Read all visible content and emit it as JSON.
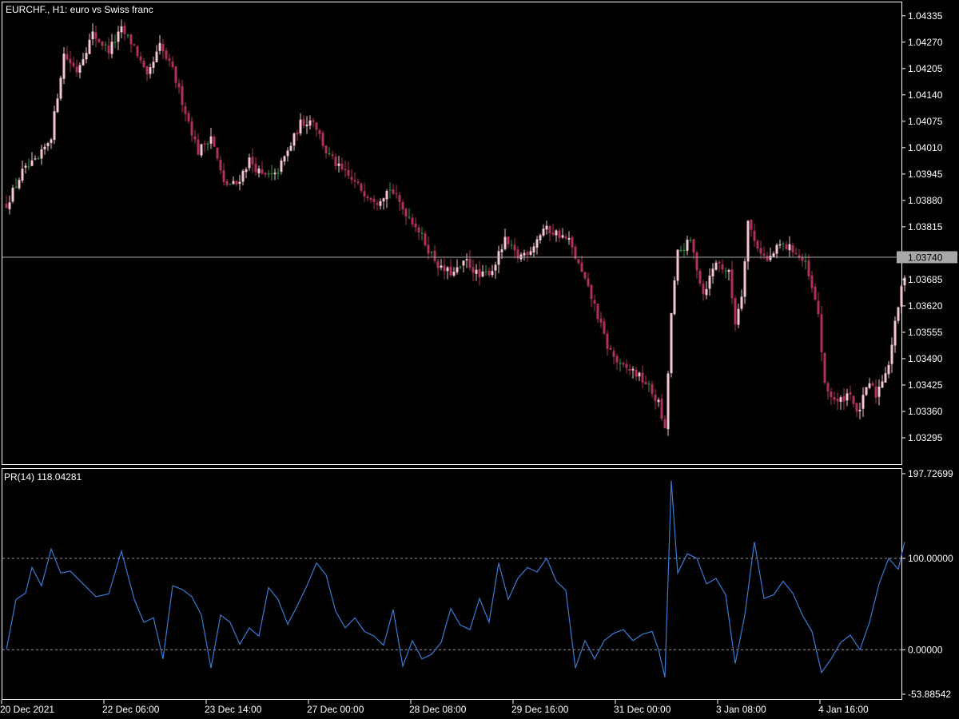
{
  "window": {
    "title": "EURCHF., H1:  euro vs Swiss franc",
    "indicator_title": "PR(14) 118.04281"
  },
  "colors": {
    "background": "#000000",
    "bull_candle": "#f5c6cf",
    "bear_candle": "#b0305a",
    "doji_candle": "#2e9e3e",
    "indicator_line": "#3a7bd5",
    "level_line": "#9a9a9a",
    "price_line": "#a8a8a8",
    "axis_text": "#ffffff",
    "price_tag_bg": "#a8a8a8"
  },
  "chart_data": [
    {
      "type": "candlestick",
      "title": "EURCHF., H1:  euro vs Swiss franc",
      "ylim": [
        1.0323,
        1.04368
      ],
      "y_ticks": [
        "1.04335",
        "1.04270",
        "1.04205",
        "1.04140",
        "1.04075",
        "1.04010",
        "1.03945",
        "1.03880",
        "1.03815",
        "1.03685",
        "1.03620",
        "1.03555",
        "1.03490",
        "1.03425",
        "1.03360",
        "1.03295"
      ],
      "current_price": "1.03740",
      "current_price_value": 1.0374,
      "grid": false,
      "close_path": [
        {
          "bar": 0,
          "close": 1.0387
        },
        {
          "bar": 5,
          "close": 1.0395
        },
        {
          "bar": 10,
          "close": 1.0398
        },
        {
          "bar": 14,
          "close": 1.0404
        },
        {
          "bar": 18,
          "close": 1.0424
        },
        {
          "bar": 22,
          "close": 1.042
        },
        {
          "bar": 27,
          "close": 1.0429
        },
        {
          "bar": 32,
          "close": 1.0425
        },
        {
          "bar": 36,
          "close": 1.043
        },
        {
          "bar": 40,
          "close": 1.0426
        },
        {
          "bar": 44,
          "close": 1.0418
        },
        {
          "bar": 48,
          "close": 1.0426
        },
        {
          "bar": 52,
          "close": 1.042
        },
        {
          "bar": 56,
          "close": 1.041
        },
        {
          "bar": 60,
          "close": 1.04
        },
        {
          "bar": 64,
          "close": 1.0404
        },
        {
          "bar": 68,
          "close": 1.0392
        },
        {
          "bar": 72,
          "close": 1.0392
        },
        {
          "bar": 76,
          "close": 1.0398
        },
        {
          "bar": 80,
          "close": 1.0394
        },
        {
          "bar": 84,
          "close": 1.0394
        },
        {
          "bar": 88,
          "close": 1.04
        },
        {
          "bar": 92,
          "close": 1.0407
        },
        {
          "bar": 96,
          "close": 1.0408
        },
        {
          "bar": 100,
          "close": 1.04
        },
        {
          "bar": 104,
          "close": 1.0396
        },
        {
          "bar": 108,
          "close": 1.0393
        },
        {
          "bar": 112,
          "close": 1.039
        },
        {
          "bar": 116,
          "close": 1.0388
        },
        {
          "bar": 120,
          "close": 1.0391
        },
        {
          "bar": 124,
          "close": 1.0386
        },
        {
          "bar": 128,
          "close": 1.0382
        },
        {
          "bar": 132,
          "close": 1.0376
        },
        {
          "bar": 136,
          "close": 1.0371
        },
        {
          "bar": 140,
          "close": 1.037
        },
        {
          "bar": 144,
          "close": 1.0373
        },
        {
          "bar": 148,
          "close": 1.0369
        },
        {
          "bar": 152,
          "close": 1.0371
        },
        {
          "bar": 156,
          "close": 1.0378
        },
        {
          "bar": 160,
          "close": 1.0374
        },
        {
          "bar": 164,
          "close": 1.0376
        },
        {
          "bar": 168,
          "close": 1.0381
        },
        {
          "bar": 172,
          "close": 1.038
        },
        {
          "bar": 176,
          "close": 1.0378
        },
        {
          "bar": 180,
          "close": 1.037
        },
        {
          "bar": 184,
          "close": 1.0362
        },
        {
          "bar": 188,
          "close": 1.0352
        },
        {
          "bar": 192,
          "close": 1.0347
        },
        {
          "bar": 196,
          "close": 1.0346
        },
        {
          "bar": 200,
          "close": 1.0343
        },
        {
          "bar": 204,
          "close": 1.0338
        },
        {
          "bar": 206,
          "close": 1.0331
        },
        {
          "bar": 208,
          "close": 1.036
        },
        {
          "bar": 210,
          "close": 1.0375
        },
        {
          "bar": 214,
          "close": 1.0378
        },
        {
          "bar": 218,
          "close": 1.0365
        },
        {
          "bar": 222,
          "close": 1.0373
        },
        {
          "bar": 226,
          "close": 1.037
        },
        {
          "bar": 228,
          "close": 1.0358
        },
        {
          "bar": 230,
          "close": 1.0365
        },
        {
          "bar": 232,
          "close": 1.0383
        },
        {
          "bar": 234,
          "close": 1.0378
        },
        {
          "bar": 238,
          "close": 1.0373
        },
        {
          "bar": 242,
          "close": 1.0377
        },
        {
          "bar": 246,
          "close": 1.0376
        },
        {
          "bar": 250,
          "close": 1.0372
        },
        {
          "bar": 254,
          "close": 1.036
        },
        {
          "bar": 256,
          "close": 1.0342
        },
        {
          "bar": 260,
          "close": 1.0338
        },
        {
          "bar": 264,
          "close": 1.0341
        },
        {
          "bar": 266,
          "close": 1.0335
        },
        {
          "bar": 270,
          "close": 1.0343
        },
        {
          "bar": 272,
          "close": 1.034
        },
        {
          "bar": 276,
          "close": 1.0348
        },
        {
          "bar": 279,
          "close": 1.0362
        },
        {
          "bar": 281,
          "close": 1.037
        }
      ]
    },
    {
      "type": "line",
      "title": "PR(14) 118.04281",
      "ylim": [
        -53.88542,
        197.72699
      ],
      "y_ticks": [
        "197.72699",
        "100.00000",
        "0.00000",
        "-53.88542"
      ],
      "levels": [
        100,
        0
      ],
      "current_value": 118.04281,
      "series": [
        {
          "points": [
            {
              "bar": 0,
              "value": 0
            },
            {
              "bar": 3,
              "value": 55
            },
            {
              "bar": 6,
              "value": 62
            },
            {
              "bar": 8,
              "value": 90
            },
            {
              "bar": 11,
              "value": 70
            },
            {
              "bar": 14,
              "value": 110
            },
            {
              "bar": 17,
              "value": 84
            },
            {
              "bar": 20,
              "value": 86
            },
            {
              "bar": 24,
              "value": 72
            },
            {
              "bar": 28,
              "value": 58
            },
            {
              "bar": 32,
              "value": 61
            },
            {
              "bar": 36,
              "value": 108
            },
            {
              "bar": 40,
              "value": 55
            },
            {
              "bar": 43,
              "value": 30
            },
            {
              "bar": 46,
              "value": 35
            },
            {
              "bar": 49,
              "value": -10
            },
            {
              "bar": 52,
              "value": 70
            },
            {
              "bar": 55,
              "value": 66
            },
            {
              "bar": 58,
              "value": 58
            },
            {
              "bar": 61,
              "value": 38
            },
            {
              "bar": 64,
              "value": -20
            },
            {
              "bar": 67,
              "value": 38
            },
            {
              "bar": 70,
              "value": 30
            },
            {
              "bar": 73,
              "value": 6
            },
            {
              "bar": 76,
              "value": 24
            },
            {
              "bar": 79,
              "value": 15
            },
            {
              "bar": 82,
              "value": 68
            },
            {
              "bar": 85,
              "value": 55
            },
            {
              "bar": 88,
              "value": 28
            },
            {
              "bar": 91,
              "value": 48
            },
            {
              "bar": 94,
              "value": 70
            },
            {
              "bar": 97,
              "value": 95
            },
            {
              "bar": 100,
              "value": 82
            },
            {
              "bar": 103,
              "value": 42
            },
            {
              "bar": 106,
              "value": 24
            },
            {
              "bar": 109,
              "value": 35
            },
            {
              "bar": 112,
              "value": 20
            },
            {
              "bar": 115,
              "value": 15
            },
            {
              "bar": 118,
              "value": 5
            },
            {
              "bar": 121,
              "value": 44
            },
            {
              "bar": 124,
              "value": -18
            },
            {
              "bar": 127,
              "value": 10
            },
            {
              "bar": 130,
              "value": -10
            },
            {
              "bar": 133,
              "value": -5
            },
            {
              "bar": 136,
              "value": 8
            },
            {
              "bar": 139,
              "value": 45
            },
            {
              "bar": 142,
              "value": 27
            },
            {
              "bar": 145,
              "value": 22
            },
            {
              "bar": 148,
              "value": 56
            },
            {
              "bar": 151,
              "value": 30
            },
            {
              "bar": 154,
              "value": 95
            },
            {
              "bar": 157,
              "value": 55
            },
            {
              "bar": 160,
              "value": 78
            },
            {
              "bar": 163,
              "value": 90
            },
            {
              "bar": 166,
              "value": 85
            },
            {
              "bar": 169,
              "value": 100
            },
            {
              "bar": 172,
              "value": 75
            },
            {
              "bar": 175,
              "value": 65
            },
            {
              "bar": 178,
              "value": -20
            },
            {
              "bar": 181,
              "value": 10
            },
            {
              "bar": 184,
              "value": -10
            },
            {
              "bar": 187,
              "value": 10
            },
            {
              "bar": 190,
              "value": 18
            },
            {
              "bar": 193,
              "value": 22
            },
            {
              "bar": 196,
              "value": 10
            },
            {
              "bar": 199,
              "value": 17
            },
            {
              "bar": 202,
              "value": 20
            },
            {
              "bar": 204,
              "value": 0
            },
            {
              "bar": 206,
              "value": -30
            },
            {
              "bar": 208,
              "value": 185
            },
            {
              "bar": 210,
              "value": 84
            },
            {
              "bar": 213,
              "value": 105
            },
            {
              "bar": 216,
              "value": 100
            },
            {
              "bar": 219,
              "value": 72
            },
            {
              "bar": 222,
              "value": 78
            },
            {
              "bar": 225,
              "value": 60
            },
            {
              "bar": 228,
              "value": -15
            },
            {
              "bar": 231,
              "value": 38
            },
            {
              "bar": 234,
              "value": 118
            },
            {
              "bar": 237,
              "value": 56
            },
            {
              "bar": 240,
              "value": 60
            },
            {
              "bar": 243,
              "value": 75
            },
            {
              "bar": 246,
              "value": 62
            },
            {
              "bar": 249,
              "value": 38
            },
            {
              "bar": 252,
              "value": 20
            },
            {
              "bar": 255,
              "value": -25
            },
            {
              "bar": 258,
              "value": -10
            },
            {
              "bar": 261,
              "value": 8
            },
            {
              "bar": 264,
              "value": 16
            },
            {
              "bar": 267,
              "value": 0
            },
            {
              "bar": 270,
              "value": 30
            },
            {
              "bar": 273,
              "value": 72
            },
            {
              "bar": 276,
              "value": 100
            },
            {
              "bar": 279,
              "value": 88
            },
            {
              "bar": 281,
              "value": 118.04
            }
          ]
        }
      ]
    }
  ],
  "x_axis": {
    "labels": [
      {
        "bar": 0,
        "text": "20 Dec 2021"
      },
      {
        "bar": 32,
        "text": "22 Dec 06:00"
      },
      {
        "bar": 64,
        "text": "23 Dec 14:00"
      },
      {
        "bar": 96,
        "text": "27 Dec 00:00"
      },
      {
        "bar": 128,
        "text": "28 Dec 08:00"
      },
      {
        "bar": 160,
        "text": "29 Dec 16:00"
      },
      {
        "bar": 192,
        "text": "31 Dec 00:00"
      },
      {
        "bar": 224,
        "text": "3 Jan 08:00"
      },
      {
        "bar": 256,
        "text": "4 Jan 16:00"
      }
    ]
  }
}
